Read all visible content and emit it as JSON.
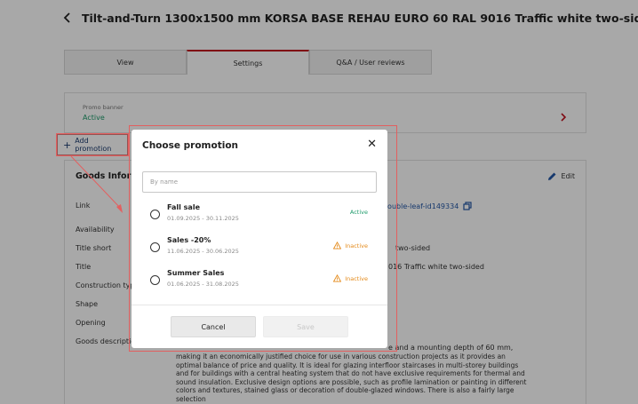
{
  "page": {
    "title": "Tilt-and-Turn 1300x1500 mm KORSA BASE REHAU EURO 60 RAL 9016 Traffic white two-sided"
  },
  "tabs": [
    {
      "label": "View",
      "active": false
    },
    {
      "label": "Settings",
      "active": true
    },
    {
      "label": "Q&A / User reviews",
      "active": false
    }
  ],
  "promo_banner": {
    "label": "Promo banner",
    "status": "Active"
  },
  "add_promotion_label": "Add promotion",
  "goods_info": {
    "title": "Goods Information",
    "edit_label": "Edit",
    "fields": [
      {
        "label": "Link",
        "value": "0-double-leaf-id149334"
      },
      {
        "label": "Availability",
        "value": ""
      },
      {
        "label": "Title short",
        "value": "two-sided"
      },
      {
        "label": "Title",
        "value": "016 Traffic white two-sided"
      },
      {
        "label": "Construction type",
        "value": ""
      },
      {
        "label": "Shape",
        "value": ""
      },
      {
        "label": "Opening",
        "value": ""
      },
      {
        "label": "Goods description",
        "value": "e and a mounting depth of 60 mm,"
      }
    ],
    "description": "making it an economically justified choice for use in various construction projects as it provides an optimal balance of price and quality. It is ideal for glazing interfloor staircases in multi-storey buildings and for buildings with a central heating system that do not have exclusive requirements for thermal and sound insulation. Exclusive design options are possible, such as profile lamination or painting in different colors and textures, stained glass or decoration of double-glazed windows. There is also a fairly large selection"
  },
  "modal": {
    "title": "Choose promotion",
    "search_placeholder": "By name",
    "promotions": [
      {
        "name": "Fall sale",
        "dates": "01.09.2025 - 30.11.2025",
        "status": "Active"
      },
      {
        "name": "Sales -20%",
        "dates": "11.06.2025 - 30.06.2025",
        "status": "Inactive"
      },
      {
        "name": "Summer Sales",
        "dates": "01.06.2025 - 31.08.2025",
        "status": "Inactive"
      }
    ],
    "cancel_label": "Cancel",
    "save_label": "Save"
  },
  "colors": {
    "accent": "#c1121f",
    "active_status": "#1e9b6b",
    "inactive_status": "#e48a1a",
    "link": "#2457a6",
    "highlight": "#e26060"
  },
  "icons": {
    "back": "chevron-left-icon",
    "promo_open": "chevron-right-icon",
    "add": "plus-icon",
    "edit": "pencil-icon",
    "copy": "copy-icon",
    "close": "close-icon",
    "inactive": "warning-icon"
  }
}
